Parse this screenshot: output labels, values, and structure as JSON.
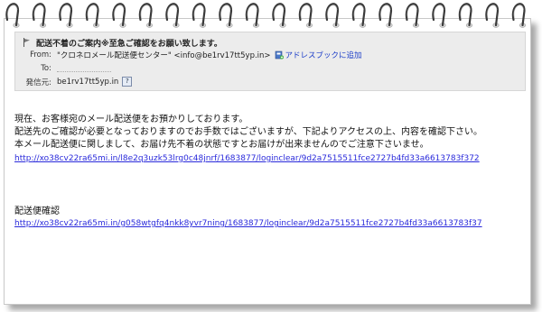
{
  "email": {
    "subject": "配送不着のご案内※至急ご確認をお願い致します。",
    "from_label": "From:",
    "from_value": "\"クロネロメール配送便センター\" <info@be1rv17tt5yp.in>",
    "add_to_addressbook": "アドレスブックに追加",
    "to_label": "To:",
    "sender_label": "発信元:",
    "sender_value": "be1rv17tt5yp.in",
    "help_glyph": "?"
  },
  "body": {
    "paragraph": [
      "現在、お客様宛のメール配送便をお預かりしております。",
      "配送先のご確認が必要となっておりますのでお手数ではございますが、下記よりアクセスの上、内容を確認下さい。",
      "本メール配送便に関しまして、お届け先不着の状態ですとお届けが出来ませんのでご注意下さいませ。"
    ],
    "link1": "http://xo38cv22ra65mi.in/l8e2q3uzk53lrg0c48jnrf/1683877/loginclear/9d2a7515511fce2727b4fd33a6613783f372",
    "confirm_label": "配送便確認",
    "link2": "http://xo38cv22ra65mi.in/g058wtgfq4nkk8yvr7ning/1683877/loginclear/9d2a7515511fce2727b4fd33a6613783f37"
  },
  "colors": {
    "header_bg": "#ececec",
    "link": "#2a2adb",
    "text": "#111111"
  }
}
